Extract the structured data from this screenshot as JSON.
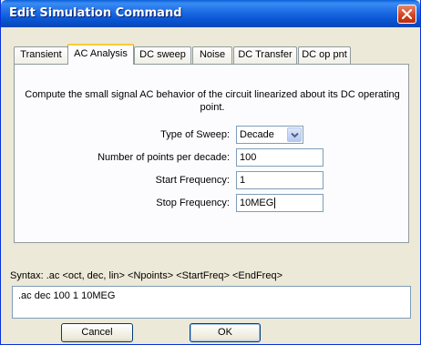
{
  "window": {
    "title": "Edit Simulation Command"
  },
  "tabs": [
    {
      "label": "Transient",
      "active": false
    },
    {
      "label": "AC Analysis",
      "active": true
    },
    {
      "label": "DC sweep",
      "active": false
    },
    {
      "label": "Noise",
      "active": false
    },
    {
      "label": "DC Transfer",
      "active": false
    },
    {
      "label": "DC op pnt",
      "active": false
    }
  ],
  "panel": {
    "description": "Compute the small signal AC behavior of the circuit linearized about its DC operating point.",
    "sweep_type": {
      "label": "Type of Sweep:",
      "value": "Decade"
    },
    "points": {
      "label": "Number of points per decade:",
      "value": "100"
    },
    "start_freq": {
      "label": "Start Frequency:",
      "value": "1"
    },
    "stop_freq": {
      "label": "Stop Frequency:",
      "value": "10MEG"
    }
  },
  "syntax": "Syntax: .ac <oct, dec, lin> <Npoints> <StartFreq> <EndFreq>",
  "command": ".ac dec 100 1 10MEG",
  "buttons": {
    "cancel": "Cancel",
    "ok": "OK"
  },
  "colors": {
    "titlebar": "#0a57d4",
    "active_tab_accent": "#ffc83c",
    "close_button": "#d1401f"
  },
  "icons": {
    "close": "close-icon",
    "dropdown": "chevron-down-icon"
  }
}
